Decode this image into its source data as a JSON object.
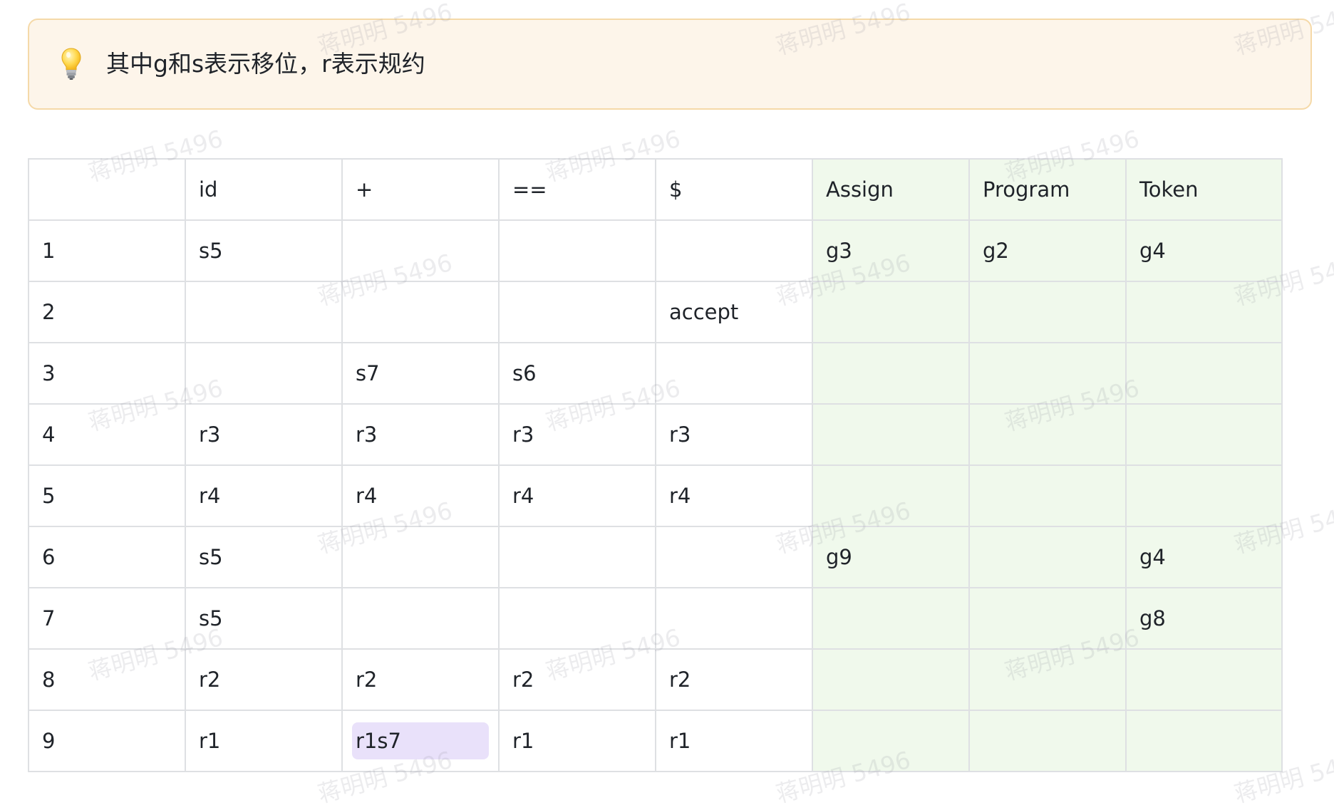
{
  "callout": {
    "icon": "lightbulb-icon",
    "text": "其中g和s表示移位，r表示规约"
  },
  "table": {
    "header": [
      "",
      "id",
      "+",
      "==",
      "$",
      "Assign",
      "Program",
      "Token"
    ],
    "rows": [
      [
        "1",
        "s5",
        "",
        "",
        "",
        "g3",
        "g2",
        "g4"
      ],
      [
        "2",
        "",
        "",
        "",
        "accept",
        "",
        "",
        ""
      ],
      [
        "3",
        "",
        "s7",
        "s6",
        "",
        "",
        "",
        ""
      ],
      [
        "4",
        "r3",
        "r3",
        "r3",
        "r3",
        "",
        "",
        ""
      ],
      [
        "5",
        "r4",
        "r4",
        "r4",
        "r4",
        "",
        "",
        ""
      ],
      [
        "6",
        "s5",
        "",
        "",
        "",
        "g9",
        "",
        "g4"
      ],
      [
        "7",
        "s5",
        "",
        "",
        "",
        "",
        "",
        "g8"
      ],
      [
        "8",
        "r2",
        "r2",
        "r2",
        "r2",
        "",
        "",
        ""
      ],
      [
        "9",
        "r1",
        "r1s7",
        "r1",
        "r1",
        "",
        "",
        ""
      ]
    ],
    "highlighted_cell": "r1s7"
  },
  "watermark": {
    "text": "蒋明明 5496"
  },
  "colors": {
    "callout_bg": "#fdf5ea",
    "callout_border": "#f5d9a8",
    "goto_bg": "#f0f9ec",
    "highlight": "#e9e1fa",
    "grid": "#dee0e3"
  }
}
